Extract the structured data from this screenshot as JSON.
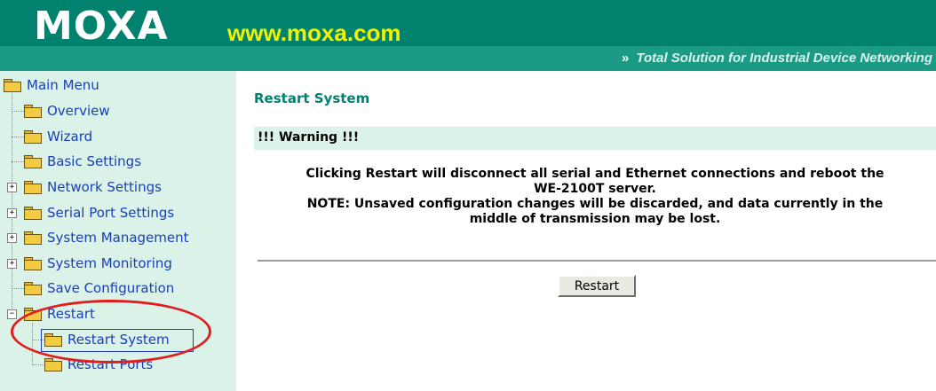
{
  "header": {
    "logo": "MOXA",
    "site": "www.moxa.com",
    "tagline_arrow": "»",
    "tagline": "Total Solution for Industrial Device Networking",
    "colors": {
      "band": "#00826f",
      "site": "#f2f200",
      "sidebar": "#daf2e7"
    }
  },
  "sidebar": {
    "items": [
      {
        "label": "Main Menu"
      },
      {
        "label": "Overview"
      },
      {
        "label": "Wizard"
      },
      {
        "label": "Basic Settings"
      },
      {
        "label": "Network Settings"
      },
      {
        "label": "Serial Port Settings"
      },
      {
        "label": "System Management"
      },
      {
        "label": "System Monitoring"
      },
      {
        "label": "Save Configuration"
      },
      {
        "label": "Restart"
      },
      {
        "label": "Restart System"
      },
      {
        "label": "Restart Ports"
      }
    ],
    "expanders": {
      "collapsed": "+",
      "expanded": "−"
    },
    "selected_item": "Restart System"
  },
  "main": {
    "title": "Restart System",
    "warning": "!!! Warning !!!",
    "message_line1": "Clicking Restart will disconnect all serial and Ethernet connections and reboot the",
    "message_line2": "WE-2100T server.",
    "message_line3": "NOTE: Unsaved configuration changes will be discarded, and data currently in the",
    "message_line4": "middle of transmission may be lost.",
    "restart_button": "Restart"
  }
}
